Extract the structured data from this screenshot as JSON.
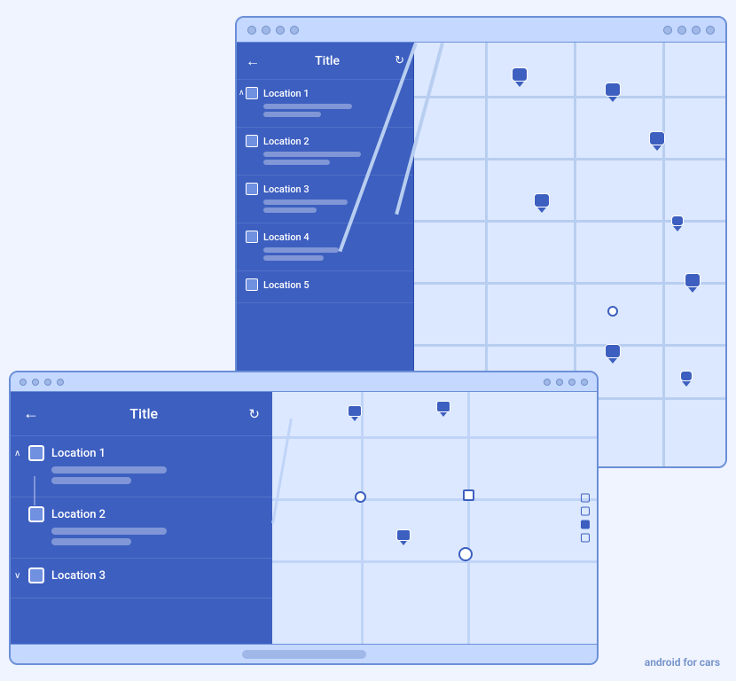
{
  "back_screen": {
    "title": "Title",
    "panel": {
      "locations": [
        {
          "name": "Location 1",
          "bar1_width": 100,
          "bar2_width": 65
        },
        {
          "name": "Location 2",
          "bar1_width": 110,
          "bar2_width": 75
        },
        {
          "name": "Location 3",
          "bar1_width": 95,
          "bar2_width": 60
        },
        {
          "name": "Location 4",
          "bar1_width": 85,
          "bar2_width": 68
        },
        {
          "name": "Location 5",
          "bar1_width": 0,
          "bar2_width": 0
        }
      ]
    }
  },
  "front_screen": {
    "title": "Title",
    "panel": {
      "locations": [
        {
          "name": "Location 1",
          "bar1_width": 130,
          "bar2_width": 90,
          "expanded": true
        },
        {
          "name": "Location 2",
          "bar1_width": 130,
          "bar2_width": 90,
          "expanded": false
        },
        {
          "name": "Location 3",
          "bar1_width": 0,
          "bar2_width": 0,
          "expanded": false
        }
      ]
    }
  },
  "brand": {
    "text1": "android",
    "text2": "for cars"
  },
  "icons": {
    "back_arrow": "←",
    "refresh": "↻",
    "chevron_up": "∧",
    "chevron_down": "∨"
  }
}
